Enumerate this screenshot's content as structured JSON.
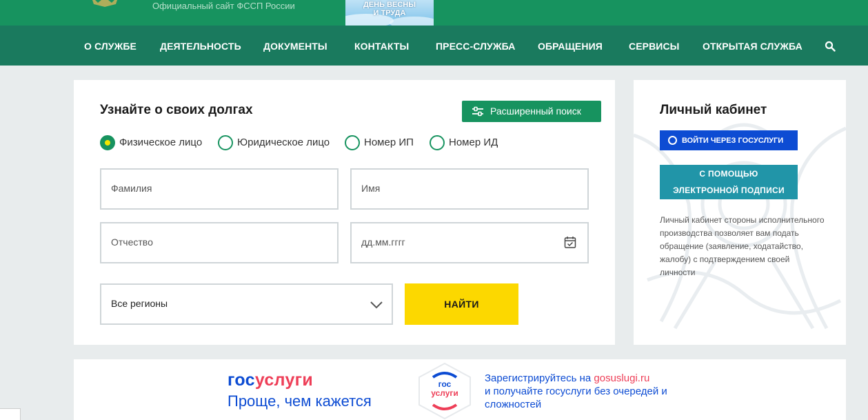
{
  "header": {
    "site_subtitle": "Официальный сайт ФССП России",
    "promo_line1": "ДЕНЬ ВЕСНЫ",
    "promo_line2": "И ТРУДА"
  },
  "nav": {
    "items": [
      "О СЛУЖБЕ",
      "ДЕЯТЕЛЬНОСТЬ",
      "ДОКУМЕНТЫ",
      "КОНТАКТЫ",
      "ПРЕСС-СЛУЖБА",
      "ОБРАЩЕНИЯ",
      "СЕРВИСЫ",
      "ОТКРЫТАЯ СЛУЖБА"
    ],
    "search_icon": "search-icon"
  },
  "debt_search": {
    "title": "Узнайте о своих долгах",
    "advanced_search_label": "Расширенный поиск",
    "radio_options": [
      "Физическое лицо",
      "Юридическое лицо",
      "Номер ИП",
      "Номер ИД"
    ],
    "selected_option": "Физическое лицо",
    "placeholders": {
      "last_name": "Фамилия",
      "first_name": "Имя",
      "patronymic": "Отчество",
      "birth_date": "дд.мм.гггг"
    },
    "region_select_value": "Все регионы",
    "find_button_label": "НАЙТИ"
  },
  "personal_cabinet": {
    "title": "Личный кабинет",
    "gosuslugi_button_label": "ВОЙТИ ЧЕРЕЗ ГОСУСЛУГИ",
    "signature_button_line1": "С ПОМОЩЬЮ",
    "signature_button_line2": "ЭЛЕКТРОННОЙ ПОДПИСИ",
    "description": "Личный кабинет стороны исполнительного производства позволяет вам подать обращение (заявление, ходатайство, жалобу) с подтверждением своей личности"
  },
  "banner": {
    "logo_part1": "гос",
    "logo_part2": "услуги",
    "tagline": "Проще, чем кажется",
    "badge_line1": "гос",
    "badge_line2": "услуги",
    "text_prefix": "Зарегистрируйтесь на ",
    "text_link": "gosuslugi.ru",
    "text_rest": "и получайте госуслуги без очередей и сложностей"
  },
  "colors": {
    "header_green": "#17935f",
    "nav_green": "#1a7a5e",
    "find_yellow": "#fcd800",
    "gosuslugi_blue": "#0d4cd3",
    "gosuslugi_red": "#ee3f58",
    "signature_teal": "#2195a8"
  }
}
